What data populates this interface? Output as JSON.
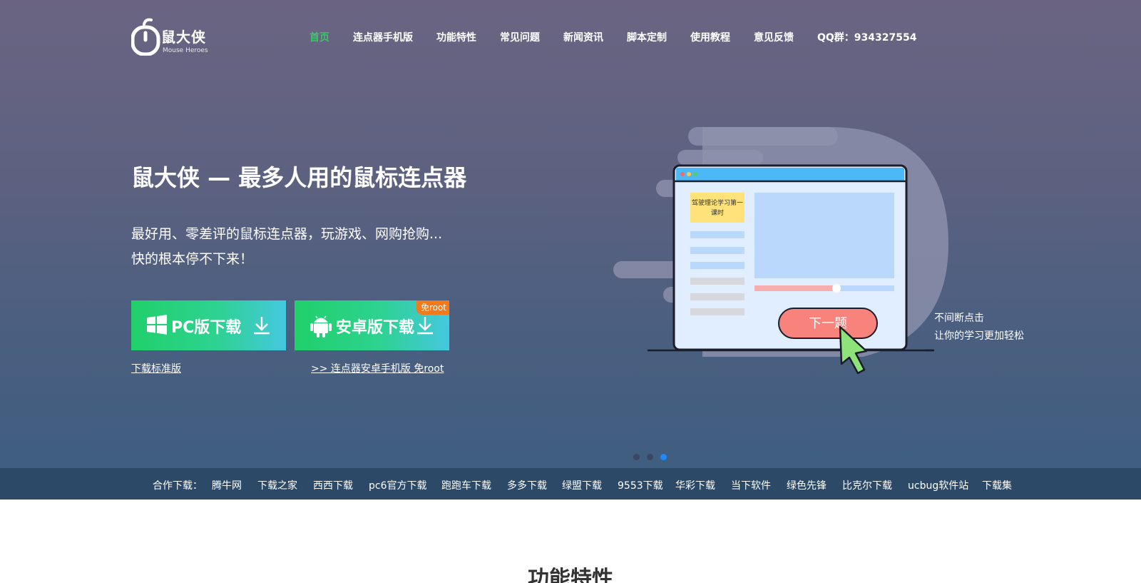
{
  "header": {
    "logo_cn": "鼠大侠",
    "logo_en": "Mouse Heroes",
    "nav": [
      "首页",
      "连点器手机版",
      "功能特性",
      "常见问题",
      "新闻资讯",
      "脚本定制",
      "使用教程",
      "意见反馈",
      "QQ群：934327554"
    ]
  },
  "hero": {
    "title": "鼠大侠 — 最多人用的鼠标连点器",
    "subtitle_line1": "最好用、零差评的鼠标连点器，玩游戏、网购抢购...",
    "subtitle_line2": "快的根本停不下来！",
    "pc_button": "PC版下载",
    "android_button": "安卓版下载",
    "android_badge": "免root",
    "standard_link": "下载标准版",
    "android_link": ">> 连点器安卓手机版 免root"
  },
  "illustration": {
    "note_text_1": "驾驶理论学习第一",
    "note_text_2": "课时",
    "next_button": "下一题",
    "caption_1": "不间断点击",
    "caption_2": "让你的学习更加轻松"
  },
  "carousel": {
    "active_index": 2,
    "count": 3
  },
  "partners": {
    "label": "合作下载：",
    "items": [
      "腾牛网",
      "下载之家",
      "西西下载",
      "pc6官方下载",
      "跑跑车下载",
      "多多下载",
      "绿盟下载",
      "9553下载",
      "华彩下载",
      "当下软件",
      "绿色先锋",
      "比克尔下载",
      "ucbug软件站",
      "下载集"
    ]
  },
  "section": {
    "title": "功能特性"
  },
  "colors": {
    "nav_active": "#3ec46d",
    "button_green": "#21d06a",
    "badge_orange": "#f07a1c",
    "partner_bar": "#2c4967",
    "dot_active": "#1e88ff"
  }
}
